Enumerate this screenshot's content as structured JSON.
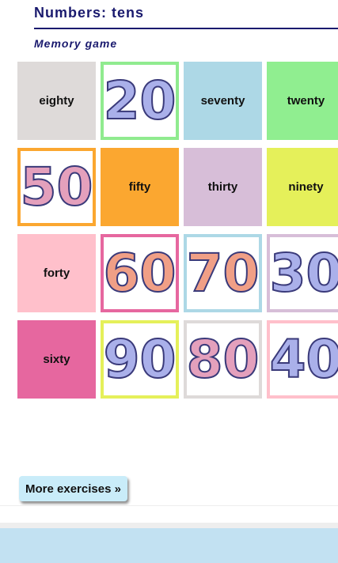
{
  "header": {
    "title": "Numbers: tens",
    "subtitle": "Memory game"
  },
  "colors": {
    "title": "#1a1a6e",
    "button_bg": "#c9ecf9",
    "footer_bg": "#c2e1f2",
    "numeral_blue": "#aab0ea",
    "numeral_pink": "#e4a0bc",
    "numeral_peach": "#f09f86",
    "numeral_outline": "#3a3a7a"
  },
  "cards": [
    {
      "kind": "word",
      "text": "eighty",
      "color": "#dedad9"
    },
    {
      "kind": "number",
      "text": "20",
      "color": "#90eb8f",
      "fill": "blue"
    },
    {
      "kind": "word",
      "text": "seventy",
      "color": "#add8e6"
    },
    {
      "kind": "word",
      "text": "twenty",
      "color": "#90ee90"
    },
    {
      "kind": "number",
      "text": "50",
      "color": "#fba730",
      "fill": "pink"
    },
    {
      "kind": "word",
      "text": "fifty",
      "color": "#fba730"
    },
    {
      "kind": "word",
      "text": "thirty",
      "color": "#d7bed8"
    },
    {
      "kind": "word",
      "text": "ninety",
      "color": "#e5f05a"
    },
    {
      "kind": "word",
      "text": "forty",
      "color": "#ffc0cb"
    },
    {
      "kind": "number",
      "text": "60",
      "color": "#e6679f",
      "fill": "peach"
    },
    {
      "kind": "number",
      "text": "70",
      "color": "#add8e6",
      "fill": "peach"
    },
    {
      "kind": "number",
      "text": "30",
      "color": "#d7bed8",
      "fill": "blue"
    },
    {
      "kind": "word",
      "text": "sixty",
      "color": "#e6679f"
    },
    {
      "kind": "number",
      "text": "90",
      "color": "#e5f05a",
      "fill": "blue"
    },
    {
      "kind": "number",
      "text": "80",
      "color": "#dedad9",
      "fill": "pink"
    },
    {
      "kind": "number",
      "text": "40",
      "color": "#ffc0cb",
      "fill": "blue"
    }
  ],
  "more_button": {
    "label": "More exercises »"
  }
}
